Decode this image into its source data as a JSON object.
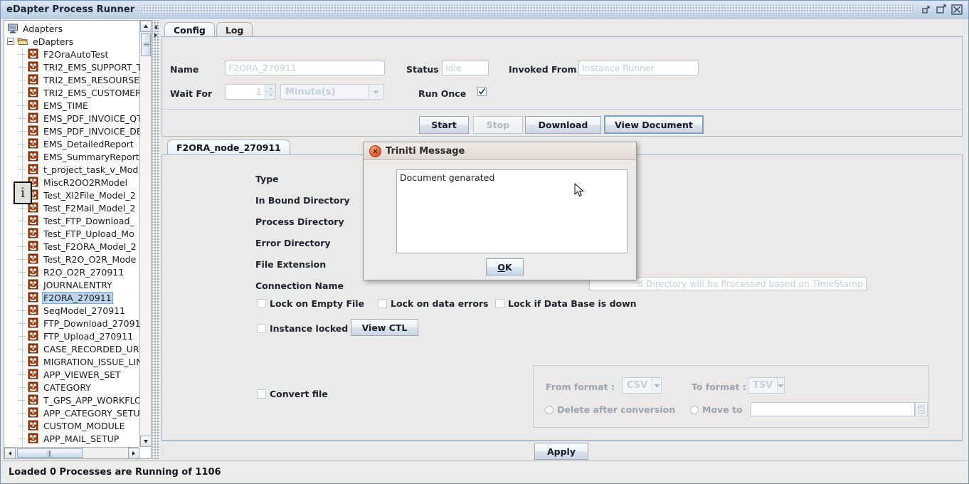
{
  "window": {
    "title": "eDapter Process Runner",
    "controls": [
      {
        "name": "minimize",
        "glyph": "minimize-icon"
      },
      {
        "name": "maximize",
        "glyph": "maximize-icon"
      },
      {
        "name": "close",
        "glyph": "close-icon"
      }
    ]
  },
  "tree": {
    "root": {
      "label": "Adapters",
      "icon": "computer-icon"
    },
    "folder": {
      "label": "eDapters",
      "icon": "open-folder-icon",
      "expanded": true
    },
    "selected": "F2ORA_270911",
    "items": [
      "F2OraAutoTest",
      "TRI2_EMS_SUPPORT_T",
      "TRI2_EMS_RESOURSE",
      "TRI2_EMS_CUSTOMER",
      "EMS_TIME",
      "EMS_PDF_INVOICE_QT",
      "EMS_PDF_INVOICE_DB",
      "EMS_DetailedReport",
      "EMS_SummaryReport",
      "t_project_task_v_Mod",
      "MiscR2OO2RModel",
      "Test_Xl2File_Model_2",
      "Test_F2Mail_Model_2",
      "Test_FTP_Download_",
      "Test_FTP_Upload_Mo",
      "Test_F2ORA_Model_2",
      "Test_R2O_O2R_Mode",
      "R2O_O2R_270911",
      "JOURNALENTRY",
      "F2ORA_270911",
      "SeqModel_270911",
      "FTP_Download_27091",
      "FTP_Upload_270911",
      "CASE_RECORDED_URI",
      "MIGRATION_ISSUE_LIN",
      "APP_VIEWER_SET",
      "CATEGORY",
      "T_GPS_APP_WORKFLO",
      "APP_CATEGORY_SETU",
      "CUSTOM_MODULE",
      "APP_MAIL_SETUP"
    ]
  },
  "tabs": {
    "items": [
      {
        "label": "Config",
        "active": true
      },
      {
        "label": "Log",
        "active": false
      }
    ]
  },
  "config": {
    "name_label": "Name",
    "name_value": "F2ORA_270911",
    "status_label": "Status",
    "status_value": "Idle",
    "invoked_from_label": "Invoked From",
    "invoked_from_value": "Instance Runner",
    "wait_for_label": "Wait For",
    "wait_for_value": "1",
    "wait_unit_value": "Minute(s)",
    "run_once_label": "Run Once",
    "run_once_checked": true
  },
  "actions": {
    "start": "Start",
    "stop": "Stop",
    "download": "Download",
    "view_document": "View Document",
    "apply": "Apply"
  },
  "node": {
    "tab_label": "F2ORA_node_270911",
    "fields": [
      {
        "label": "Type"
      },
      {
        "label": "In Bound Directory"
      },
      {
        "label": "Process Directory"
      },
      {
        "label": "Error Directory"
      },
      {
        "label": "File Extension"
      },
      {
        "label": "Connection Name"
      }
    ],
    "timestamp_note": "d Directory will be Processed based on TimeStamp",
    "checkboxes": [
      {
        "label": "Lock on Empty File",
        "checked": false
      },
      {
        "label": "Lock on data errors",
        "checked": false
      },
      {
        "label": "Lock if Data Base is down",
        "checked": false
      }
    ],
    "instance_locked_label": "Instance locked",
    "instance_locked_checked": false,
    "view_ctl_label": "View CTL",
    "convert": {
      "convert_file_label": "Convert file",
      "convert_file_checked": false,
      "from_format_label": "From format :",
      "from_format_value": "CSV",
      "to_format_label": "To format :",
      "to_format_value": "TSV",
      "delete_after_label": "Delete after conversion",
      "delete_after_checked": false,
      "move_to_label": "Move to",
      "move_to_value": "",
      "browse_icon": "browse-icon"
    }
  },
  "dialog": {
    "title": "Triniti Message",
    "close_icon": "close-icon",
    "info_icon": "info-icon",
    "message": "Document genarated",
    "ok_label": "OK",
    "ok_mnemonic": "O"
  },
  "status": {
    "text": "Loaded    0 Processes are Running of 1106"
  },
  "colors": {
    "titlebar": "#c9d8ea",
    "selection": "#bcd4ec",
    "dialog_title": "#e9e0da",
    "accent": "#7aa6d2"
  }
}
